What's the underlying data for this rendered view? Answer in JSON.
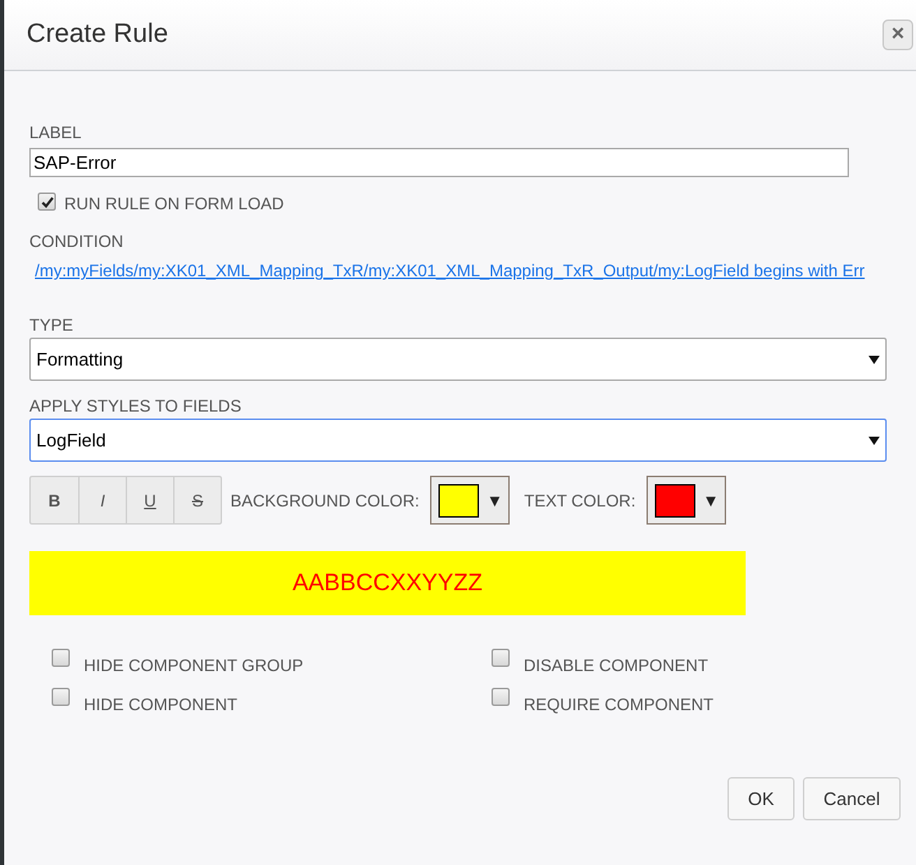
{
  "dialog": {
    "title": "Create Rule",
    "close": "×"
  },
  "label_field": {
    "label": "LABEL",
    "value": "SAP-Error"
  },
  "run_on_load": {
    "label": "RUN RULE ON FORM LOAD",
    "checked": true
  },
  "condition": {
    "label": "CONDITION",
    "link": "/my:myFields/my:XK01_XML_Mapping_TxR/my:XK01_XML_Mapping_TxR_Output/my:LogField begins with Err"
  },
  "type_field": {
    "label": "TYPE",
    "value": "Formatting",
    "focused": false
  },
  "apply_field": {
    "label": "APPLY STYLES TO FIELDS",
    "value": "LogField",
    "focused": true
  },
  "format_buttons": [
    {
      "kind": "bold",
      "label": "B"
    },
    {
      "kind": "italic",
      "label": "I"
    },
    {
      "kind": "underline",
      "label": "U"
    },
    {
      "kind": "strike",
      "label": "S"
    }
  ],
  "background_color": {
    "label": "BACKGROUND COLOR:",
    "color": "#ffff00",
    "caret": "▼"
  },
  "text_color": {
    "label": "TEXT COLOR:",
    "color": "#ff0000",
    "caret": "▼"
  },
  "preview": {
    "text": "AABBCCXXYYZZ"
  },
  "options": [
    {
      "label": "HIDE COMPONENT GROUP",
      "checked": false
    },
    {
      "label": "DISABLE COMPONENT",
      "checked": false
    },
    {
      "label": "HIDE COMPONENT",
      "checked": false
    },
    {
      "label": "REQUIRE COMPONENT",
      "checked": false
    }
  ],
  "buttons": [
    "OK",
    "Cancel"
  ]
}
